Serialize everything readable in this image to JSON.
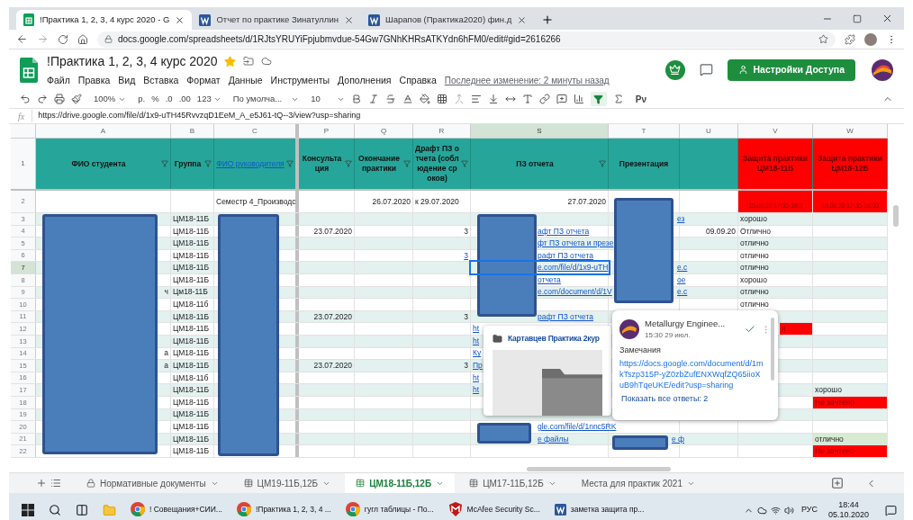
{
  "browser": {
    "tabs": [
      {
        "title": "!Практика 1, 2, 3, 4 курс 2020 - G",
        "kind": "sheets",
        "selected": true
      },
      {
        "title": "Отчет по практике Зинатуллин",
        "kind": "word",
        "selected": false
      },
      {
        "title": "Шарапов (Практика2020) фин.д",
        "kind": "word",
        "selected": false
      }
    ],
    "address": "docs.google.com/spreadsheets/d/1RJtsYRUYiFpjubmvdue-54Gw7GNhKHRsATKYdn6hFM0/edit#gid=2616266"
  },
  "doc": {
    "title": "!Практика 1, 2, 3, 4 курс 2020",
    "starred": true,
    "menu": [
      "Файл",
      "Правка",
      "Вид",
      "Вставка",
      "Формат",
      "Данные",
      "Инструменты",
      "Дополнения",
      "Справка"
    ],
    "last_edit": "Последнее изменение: 2 минуты назад",
    "share_button": "Настройки Доступа"
  },
  "toolbar": {
    "zoom": "100%",
    "currency": "р.",
    "percent": "%",
    "decrease_decimals": ".0",
    "increase_decimals": ".00",
    "format": "123",
    "font": "По умолча...",
    "font_size": "10",
    "filter_on": true,
    "input_tools": "Рν"
  },
  "formula_bar": {
    "label": "fx",
    "value": "https://drive.google.com/file/d/1x9-uTH45RvvzqD1EeM_A_e5J61-tQ--3/view?usp=sharing"
  },
  "grid": {
    "columns": [
      {
        "letter": "A",
        "selected": false
      },
      {
        "letter": "B",
        "selected": false
      },
      {
        "letter": "C",
        "selected": false
      },
      {
        "letter": "P",
        "selected": false
      },
      {
        "letter": "Q",
        "selected": false
      },
      {
        "letter": "R",
        "selected": false
      },
      {
        "letter": "S",
        "selected": true
      },
      {
        "letter": "T",
        "selected": false
      },
      {
        "letter": "U",
        "selected": false
      },
      {
        "letter": "V",
        "selected": false
      },
      {
        "letter": "W",
        "selected": false
      }
    ],
    "header_row": "1",
    "header": [
      {
        "text": "ФИО студента",
        "kind": "header",
        "filter": true
      },
      {
        "text": "Группа",
        "kind": "header",
        "filter": true
      },
      {
        "text": "ФИО руководителя",
        "kind": "header_link",
        "filter": true
      },
      {
        "text": "Консультация",
        "kind": "header",
        "filter": true
      },
      {
        "text": "Окончание практики",
        "kind": "header",
        "filter": true
      },
      {
        "text": "Драфт ПЗ отчета (соблюдение сроков)",
        "kind": "header",
        "filter": true
      },
      {
        "text": "ПЗ отчета",
        "kind": "header",
        "filter": true
      },
      {
        "text": "Презентация",
        "kind": "header",
        "filter": false
      },
      {
        "kind": "header",
        "filter": false
      },
      {
        "text": "Защита практики ЦМ18-11Б",
        "kind": "alert",
        "filter": false
      },
      {
        "text": "Защита практики ЦМ18-12Б",
        "kind": "alert",
        "filter": false
      }
    ],
    "rows": [
      {
        "number": "2",
        "selected": false,
        "cells": {
          "C": {
            "text": "Семестр 4_Производс",
            "kind": "text"
          },
          "Q": {
            "text": "26.07.2020",
            "kind": "number"
          },
          "R": {
            "text": "к 29.07.2020",
            "kind": "text"
          },
          "S": {
            "text": "27.07.2020",
            "kind": "number"
          },
          "V": {
            "text": "15.09.20 17:30-18:3",
            "kind": "alert"
          },
          "W": {
            "text": "18.09.20 17:30-18:30",
            "kind": "alert"
          }
        }
      },
      {
        "number": "3",
        "selected": false,
        "cells": {
          "B": {
            "text": "ЦМ18-11Б",
            "kind": "text"
          },
          "T": {
            "text": "ез",
            "kind": "link"
          },
          "V": {
            "text": "хорошо",
            "kind": "text"
          }
        }
      },
      {
        "number": "4",
        "selected": false,
        "cells": {
          "B": {
            "text": "ЦМ18-11Б",
            "kind": "text"
          },
          "P": {
            "text": "23.07.2020",
            "kind": "number"
          },
          "R": {
            "text": "3",
            "kind": "number"
          },
          "S": {
            "text": "афт ПЗ отчета",
            "kind": "link"
          },
          "U": {
            "text": "09.09.20",
            "kind": "number"
          },
          "V": {
            "text": "Отлично",
            "kind": "text"
          }
        }
      },
      {
        "number": "5",
        "selected": false,
        "cells": {
          "B": {
            "text": "ЦМ18-11Б",
            "kind": "text"
          },
          "S": {
            "text": "фт ПЗ отчета и презе",
            "kind": "link"
          },
          "V": {
            "text": "отлично",
            "kind": "text"
          }
        }
      },
      {
        "number": "6",
        "selected": false,
        "cells": {
          "B": {
            "text": "ЦМ18-11Б",
            "kind": "text"
          },
          "R": {
            "text": "3",
            "kind": "link_number"
          },
          "S": {
            "text": "рафт ПЗ отчета",
            "kind": "link"
          },
          "V": {
            "text": "отлично",
            "kind": "text"
          }
        }
      },
      {
        "number": "7",
        "selected": true,
        "cells": {
          "B": {
            "text": "ЦМ18-11Б",
            "kind": "text"
          },
          "S": {
            "text": "e.com/file/d/1x9-uTH",
            "kind": "link"
          },
          "T": {
            "text": "e.c",
            "kind": "link"
          },
          "V": {
            "text": "отлично",
            "kind": "text"
          }
        }
      },
      {
        "number": "8",
        "selected": false,
        "cells": {
          "B": {
            "text": "ЦМ18-11Б",
            "kind": "text"
          },
          "S": {
            "text": "отчета",
            "kind": "link"
          },
          "T": {
            "text": "ое",
            "kind": "link"
          },
          "V": {
            "text": "хорошо",
            "kind": "text"
          }
        }
      },
      {
        "number": "9",
        "selected": false,
        "cells": {
          "A": {
            "text": "ч",
            "kind": "number"
          },
          "B": {
            "text": "Цм18-11Б",
            "kind": "text"
          },
          "S": {
            "text": "e.com/document/d/1V",
            "kind": "link"
          },
          "T": {
            "text": "e.c",
            "kind": "link"
          },
          "V": {
            "text": "отлично",
            "kind": "text"
          }
        }
      },
      {
        "number": "10",
        "selected": false,
        "cells": {
          "B": {
            "text": "ЦМ18-11б",
            "kind": "text"
          },
          "V": {
            "text": "отлично",
            "kind": "text"
          }
        }
      },
      {
        "number": "11",
        "selected": false,
        "cells": {
          "B": {
            "text": "ЦМ18-11Б",
            "kind": "text"
          },
          "P": {
            "text": "23.07.2020",
            "kind": "number"
          },
          "R": {
            "text": "3",
            "kind": "number"
          },
          "S": {
            "text": "рафт ПЗ отчета",
            "kind": "link"
          }
        }
      },
      {
        "number": "12",
        "selected": false,
        "cells": {
          "B": {
            "text": "ЦМ18-11Б",
            "kind": "text"
          },
          "S": {
            "text": "ht",
            "kind": "link"
          },
          "V": {
            "text": "я",
            "kind": "fail"
          }
        }
      },
      {
        "number": "13",
        "selected": false,
        "cells": {
          "B": {
            "text": "ЦМ18-11Б",
            "kind": "text"
          },
          "S": {
            "text": "ht",
            "kind": "link"
          }
        }
      },
      {
        "number": "14",
        "selected": false,
        "cells": {
          "A": {
            "text": "а",
            "kind": "number"
          },
          "B": {
            "text": "ЦМ18-11Б",
            "kind": "text"
          },
          "S": {
            "text": "Ку",
            "kind": "link"
          }
        }
      },
      {
        "number": "15",
        "selected": false,
        "cells": {
          "A": {
            "text": "а",
            "kind": "number"
          },
          "B": {
            "text": "ЦМ18-11Б",
            "kind": "text"
          },
          "P": {
            "text": "23.07.2020",
            "kind": "number"
          },
          "R": {
            "text": "3",
            "kind": "number"
          },
          "S": {
            "text": "Пр",
            "kind": "link"
          }
        }
      },
      {
        "number": "16",
        "selected": false,
        "cells": {
          "B": {
            "text": "ЦМ18-11б",
            "kind": "text"
          },
          "S": {
            "text": "ht",
            "kind": "link"
          }
        }
      },
      {
        "number": "17",
        "selected": false,
        "cells": {
          "B": {
            "text": "ЦМ18-11Б",
            "kind": "text"
          },
          "S": {
            "text": "ht",
            "kind": "link"
          },
          "W": {
            "text": "хорошо",
            "kind": "text"
          }
        }
      },
      {
        "number": "18",
        "selected": false,
        "cells": {
          "B": {
            "text": "ЦМ18-11Б",
            "kind": "text"
          },
          "W": {
            "text": "Не зачтено",
            "kind": "fail"
          }
        }
      },
      {
        "number": "19",
        "selected": false,
        "cells": {
          "B": {
            "text": "ЦМ18-11Б",
            "kind": "text"
          }
        }
      },
      {
        "number": "20",
        "selected": false,
        "cells": {
          "B": {
            "text": "ЦМ18-11Б",
            "kind": "text"
          },
          "S": {
            "text": "gle.com/file/d/1nnc5RK",
            "kind": "link"
          }
        }
      },
      {
        "number": "21",
        "selected": false,
        "cells": {
          "B": {
            "text": "ЦМ18-11Б",
            "kind": "text"
          },
          "S": {
            "text": "е файлы",
            "kind": "link"
          },
          "T": {
            "text": "е ф",
            "kind": "link"
          },
          "W": {
            "text": "отлично",
            "kind": "good"
          }
        }
      },
      {
        "number": "22",
        "selected": false,
        "cells": {
          "B": {
            "text": "ЦМ18-11Б",
            "kind": "text"
          },
          "W": {
            "text": "Не зачтено",
            "kind": "fail"
          }
        }
      }
    ]
  },
  "drive_chip": {
    "title": "Картавцев Практика 2кур"
  },
  "comment": {
    "author": "Metallurgy Enginee...",
    "time": "15:30 29 июл.",
    "text": "Замечания",
    "link": "https://docs.google.com/document/d/1mkTszp315P-yZ0zbZufENXWqfZQ65iioXuB9hTqeUKE/edit?usp=sharing",
    "replies": "Показать все ответы: 2"
  },
  "sheet_tabs": [
    {
      "label": "Нормативные документы",
      "kind": "protected",
      "selected": false
    },
    {
      "label": "ЦМ19-11Б,12Б",
      "kind": "sheet",
      "selected": false
    },
    {
      "label": "ЦМ18-11Б,12Б",
      "kind": "sheet",
      "selected": true
    },
    {
      "label": "ЦМ17-11Б,12Б",
      "kind": "sheet",
      "selected": false
    },
    {
      "label": "Места для практик 2021",
      "kind": "plain",
      "selected": false
    }
  ],
  "taskbar": {
    "apps": [
      {
        "label": "! Совещания+СИИ...",
        "kind": "browser"
      },
      {
        "label": "!Практика 1, 2, 3, 4 ...",
        "kind": "browser"
      },
      {
        "label": "гугл таблицы - По...",
        "kind": "browser"
      },
      {
        "label": "McAfee Security Sc...",
        "kind": "antivirus"
      },
      {
        "label": "заметка защита пр...",
        "kind": "word"
      }
    ],
    "language": "РУС",
    "time": "18:44",
    "date": "05.10.2020"
  }
}
